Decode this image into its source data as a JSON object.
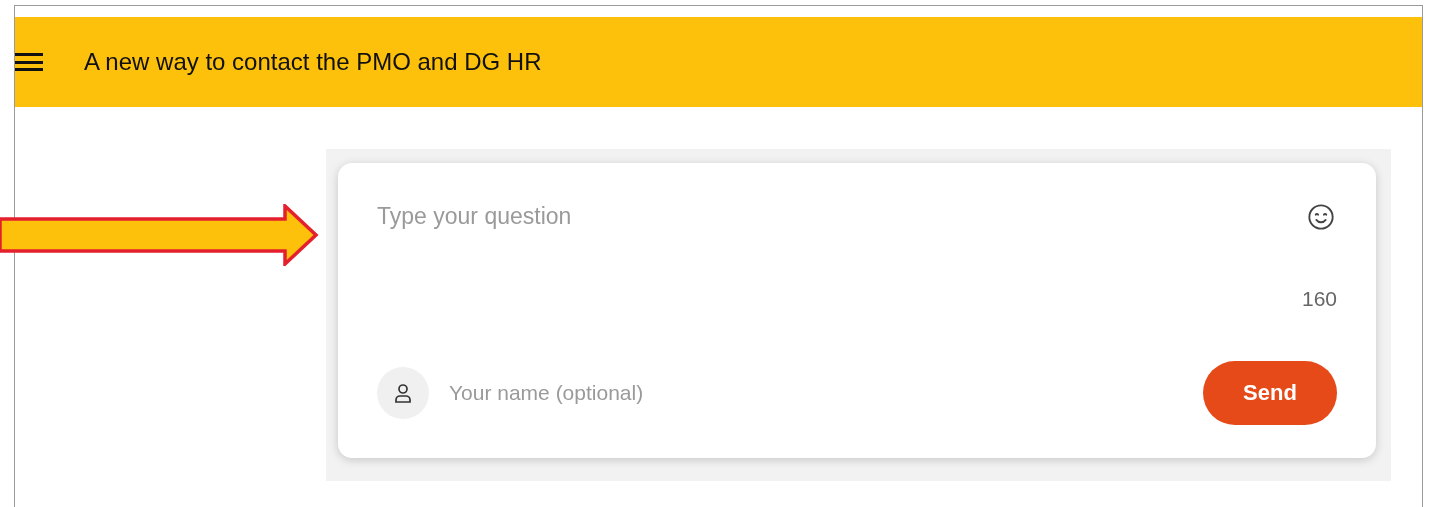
{
  "header": {
    "title": "A new way to contact the PMO and DG HR"
  },
  "question_form": {
    "question_placeholder": "Type your question",
    "char_count": "160",
    "name_placeholder": "Your name (optional)",
    "send_label": "Send"
  }
}
